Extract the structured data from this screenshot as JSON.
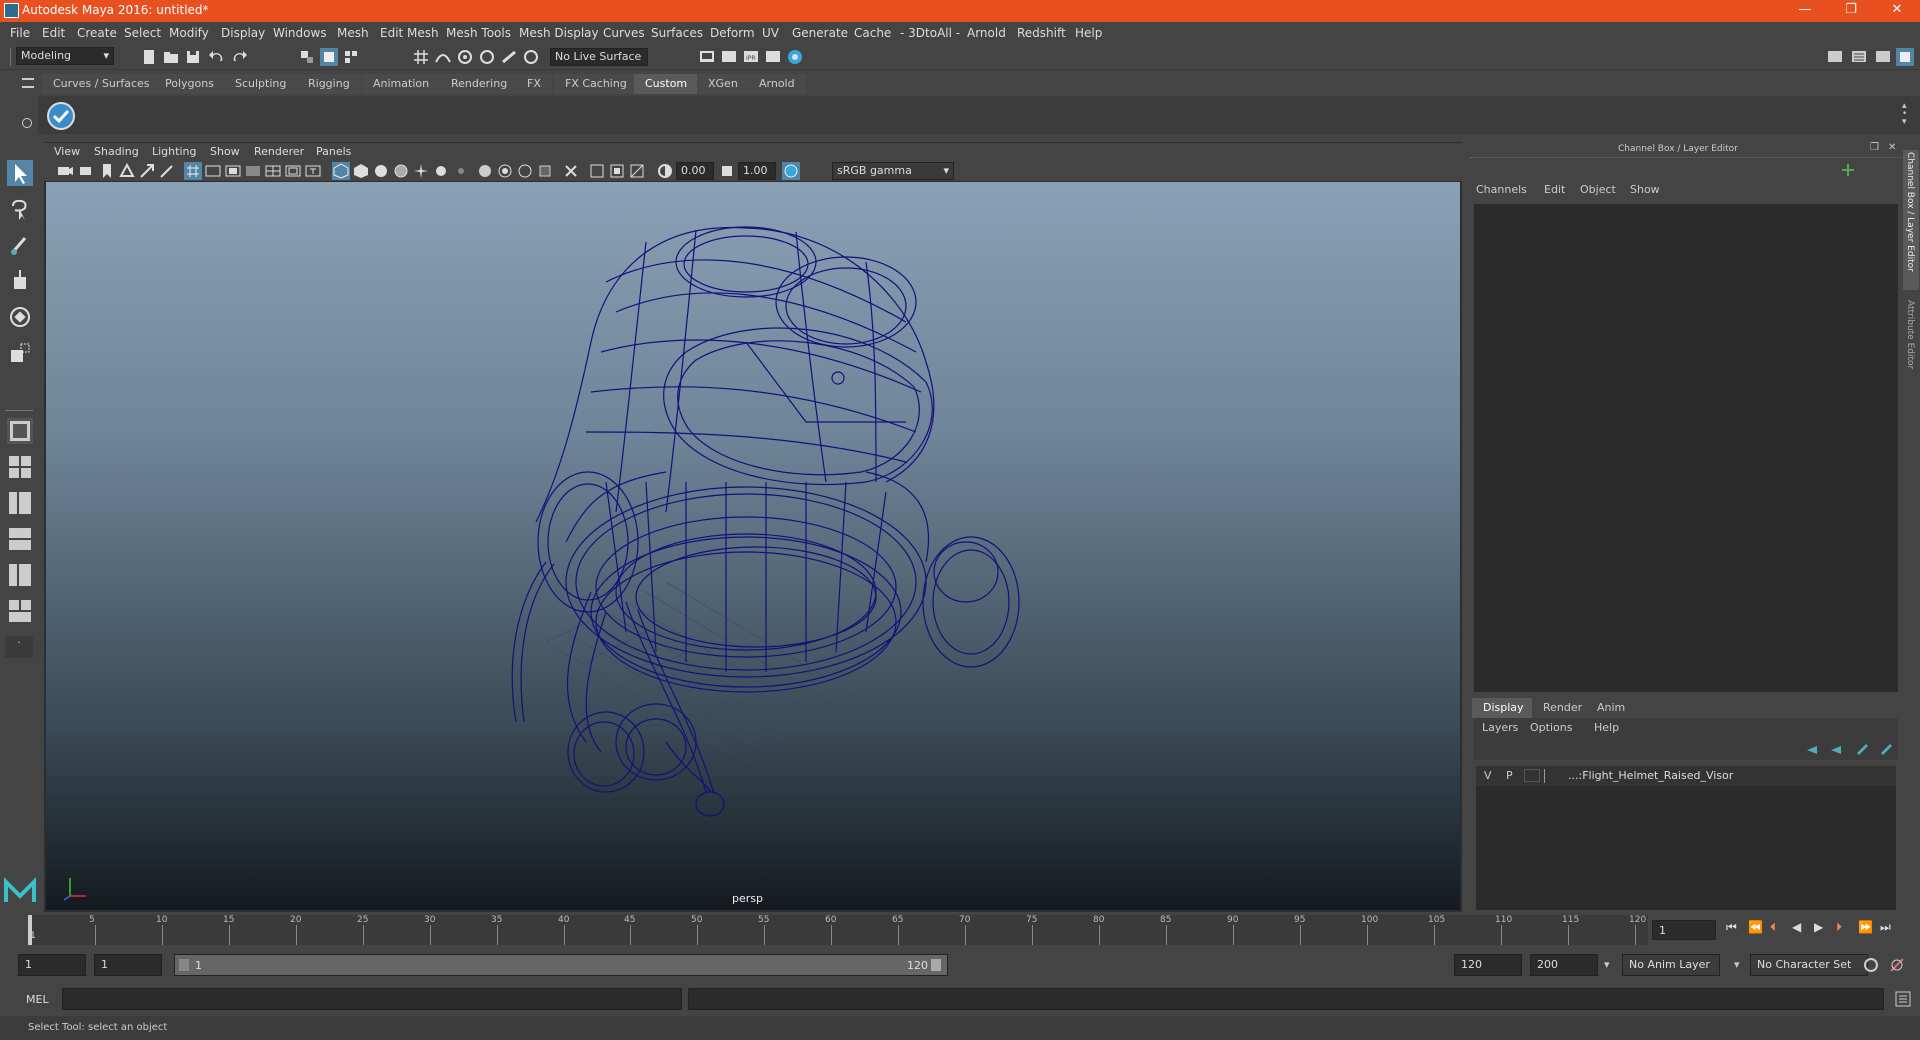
{
  "window": {
    "title": "Autodesk Maya 2016: untitled*",
    "min": "—",
    "max": "❐",
    "close": "✕"
  },
  "menus": [
    "File",
    "Edit",
    "Create",
    "Select",
    "Modify",
    "Display",
    "Windows",
    "Mesh",
    "Edit Mesh",
    "Mesh Tools",
    "Mesh Display",
    "Curves",
    "Surfaces",
    "Deform",
    "UV",
    "Generate",
    "Cache",
    "- 3DtoAll -",
    "Arnold",
    "Redshift",
    "Help"
  ],
  "statusline": {
    "workspace": "Modeling",
    "live_surface": "No Live Surface"
  },
  "shelf": {
    "tabs": [
      "Curves / Surfaces",
      "Polygons",
      "Sculpting",
      "Rigging",
      "Animation",
      "Rendering",
      "FX",
      "FX Caching",
      "Custom",
      "XGen",
      "Arnold"
    ],
    "active_tab": "Custom"
  },
  "panel": {
    "menus": [
      "View",
      "Shading",
      "Lighting",
      "Show",
      "Renderer",
      "Panels"
    ],
    "exposure": "0.00",
    "gamma": "1.00",
    "color_space": "sRGB gamma",
    "camera_label": "persp"
  },
  "channel_box": {
    "title": "Channel Box / Layer Editor",
    "menus": [
      "Channels",
      "Edit",
      "Object",
      "Show"
    ]
  },
  "layer_editor": {
    "tabs": [
      "Display",
      "Render",
      "Anim"
    ],
    "active_tab": "Display",
    "menus": [
      "Layers",
      "Options",
      "Help"
    ],
    "layer": {
      "v": "V",
      "p": "P",
      "name": "...:Flight_Helmet_Raised_Visor"
    }
  },
  "side_tabs": [
    "Channel Box / Layer Editor",
    "Attribute Editor"
  ],
  "timeline": {
    "ticks": [
      "5",
      "10",
      "15",
      "20",
      "25",
      "30",
      "35",
      "40",
      "45",
      "50",
      "55",
      "60",
      "65",
      "70",
      "75",
      "80",
      "85",
      "90",
      "95",
      "100",
      "105",
      "110",
      "115",
      "120"
    ],
    "start_marker": "1",
    "current_frame": "1"
  },
  "range": {
    "start": "1",
    "playback_start": "1",
    "slider_start": "1",
    "slider_end": "120",
    "playback_end": "120",
    "end": "200",
    "anim_layer": "No Anim Layer",
    "char_set": "No Character Set"
  },
  "cmdline": {
    "label": "MEL"
  },
  "helpline": {
    "text": "Select Tool: select an object"
  },
  "colors": {
    "titlebar": "#e8511f",
    "wireframe": "#14107a",
    "active_tab": "#5a5a5a"
  }
}
